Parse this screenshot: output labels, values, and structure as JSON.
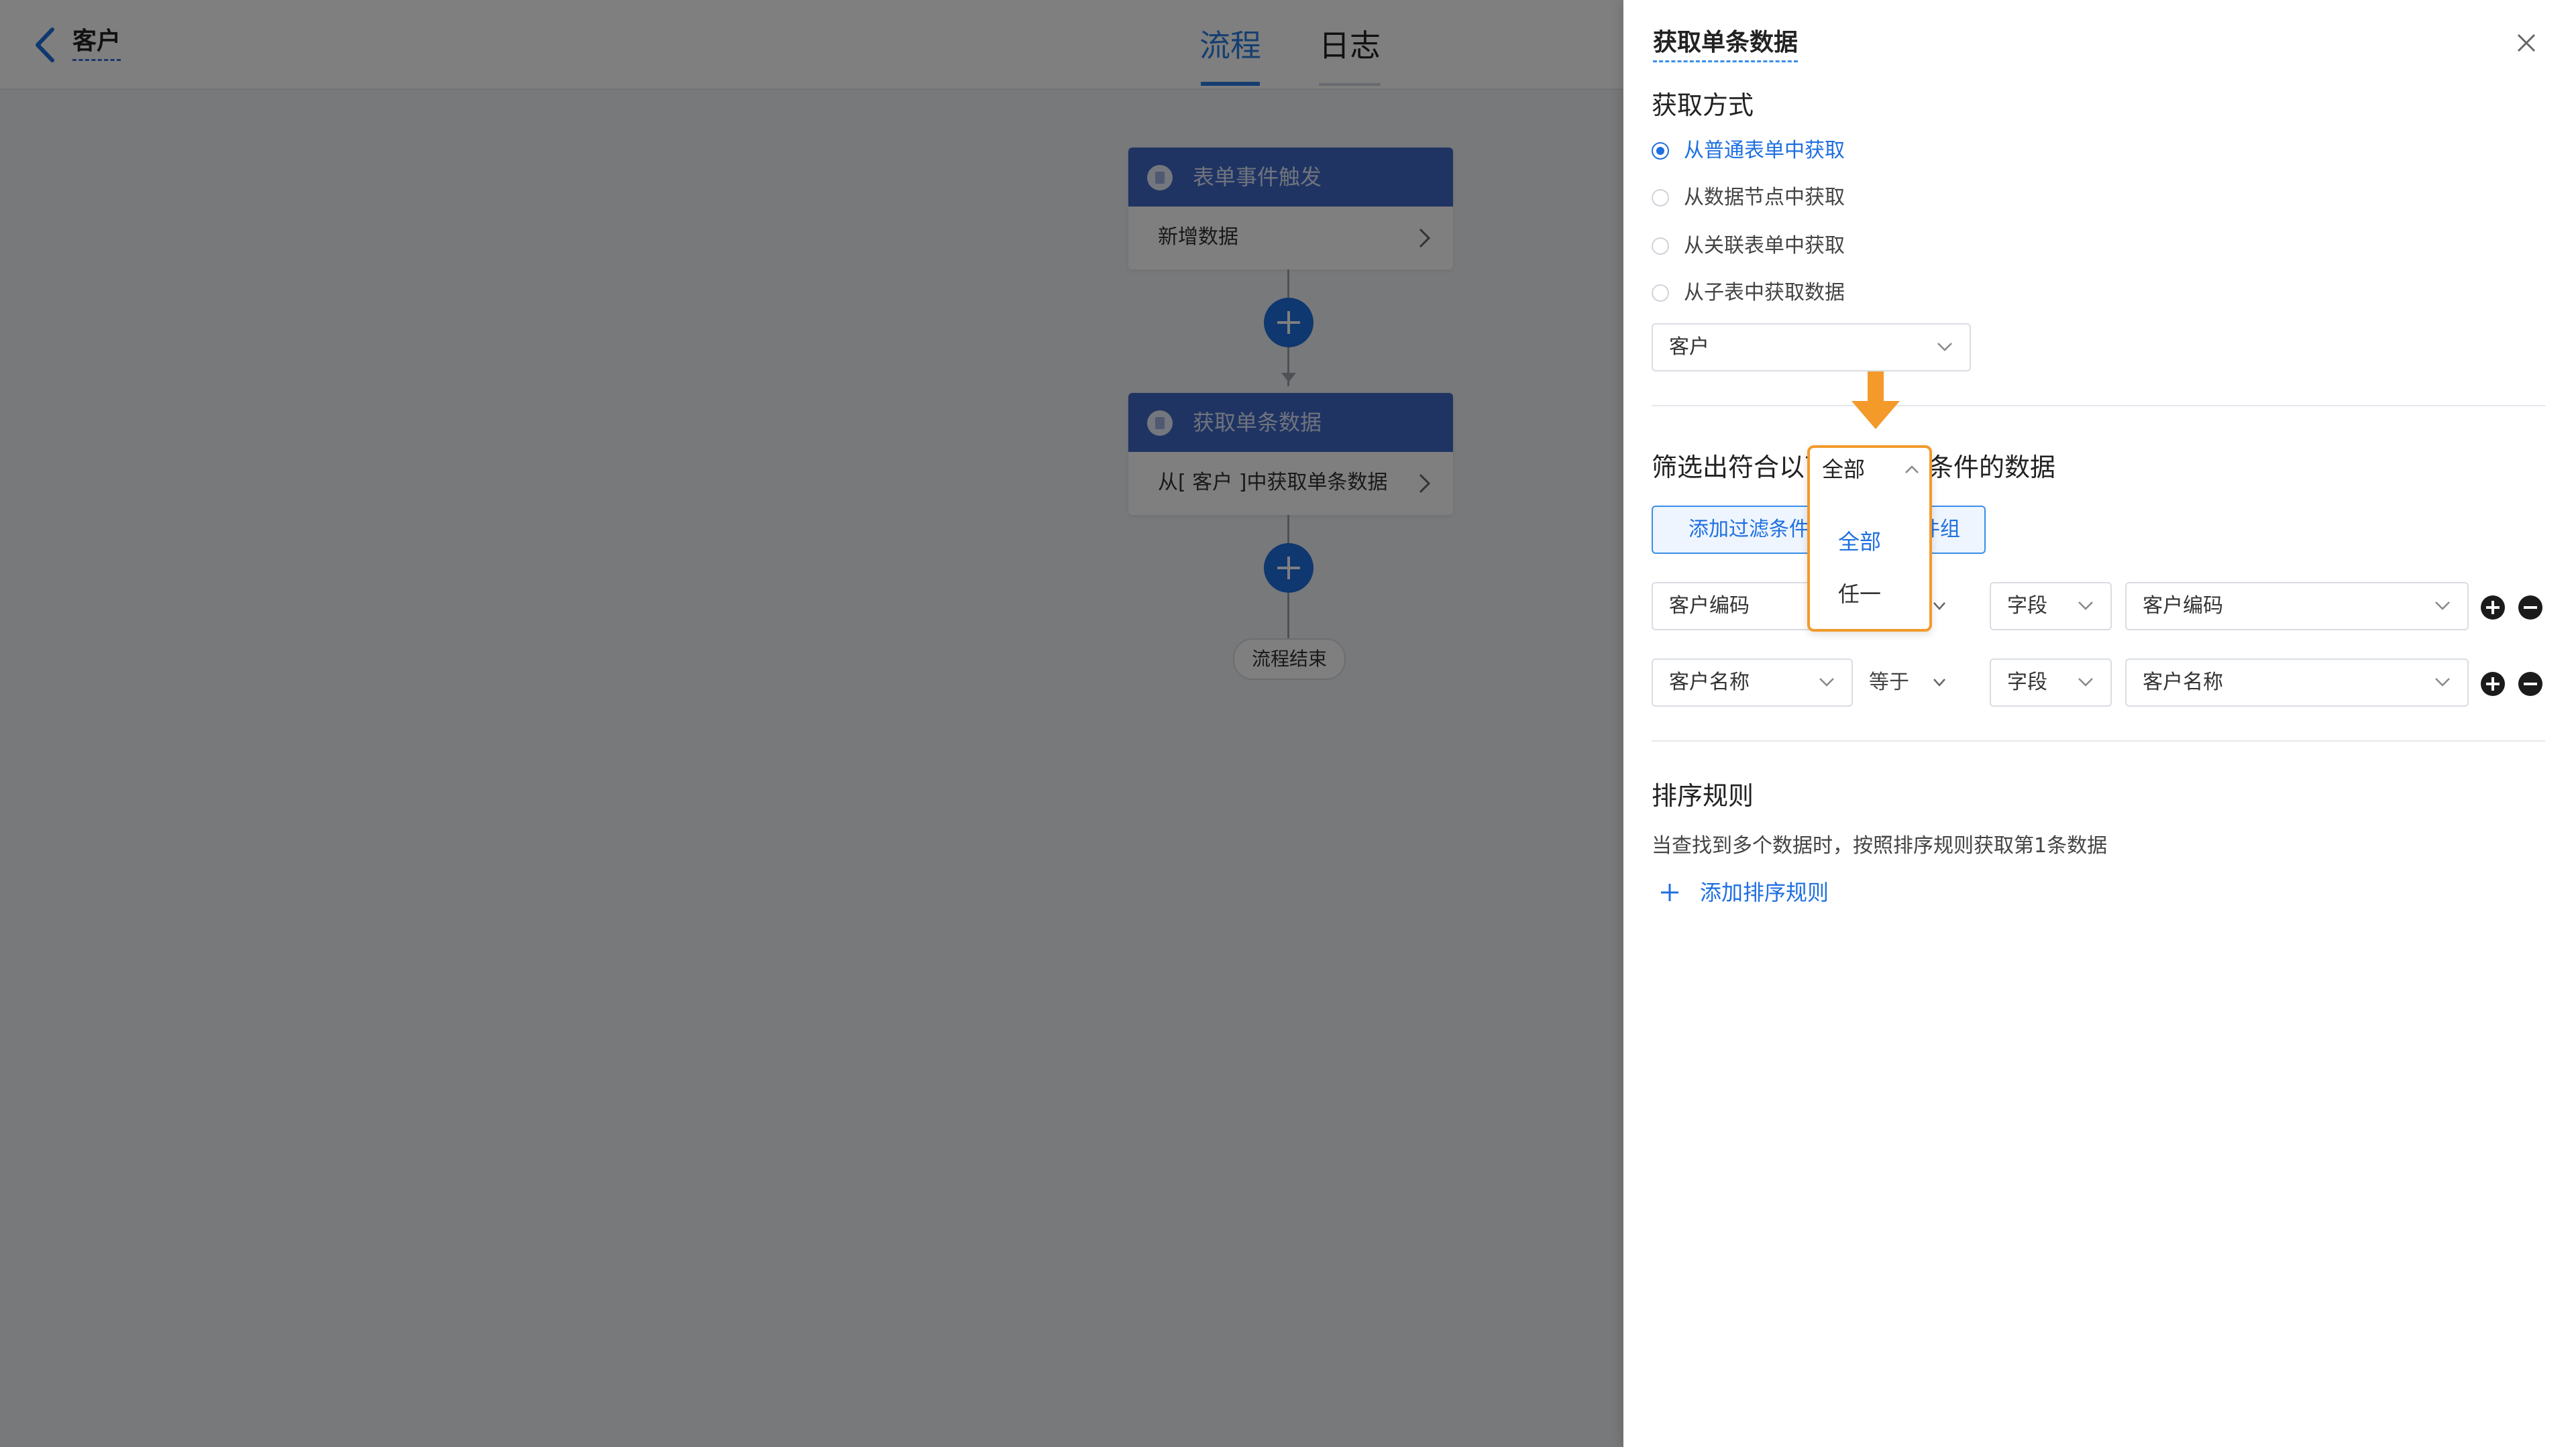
{
  "header": {
    "title": "客户",
    "tabs": [
      {
        "label": "流程",
        "active": true
      },
      {
        "label": "日志",
        "active": false
      }
    ]
  },
  "flow": {
    "nodes": [
      {
        "title": "表单事件触发",
        "body": "新增数据"
      },
      {
        "title": "获取单条数据",
        "body": "从[ 客户 ]中获取单条数据"
      }
    ],
    "end_label": "流程结束"
  },
  "drawer": {
    "title": "获取单条数据",
    "fetch_method": {
      "label": "获取方式",
      "options": [
        {
          "label": "从普通表单中获取",
          "selected": true
        },
        {
          "label": "从数据节点中获取",
          "selected": false
        },
        {
          "label": "从关联表单中获取",
          "selected": false
        },
        {
          "label": "从子表中获取数据",
          "selected": false
        }
      ]
    },
    "form_select": {
      "value": "客户"
    },
    "filter": {
      "label_pre": "筛选出符合以下",
      "label_post": "条件的数据",
      "match_mode": {
        "current": "全部",
        "options": [
          "全部",
          "任一"
        ],
        "selected": "全部"
      },
      "add_filter_label": "添加过滤条件",
      "add_group_label": "条件组",
      "conditions": [
        {
          "field": "客户编码",
          "operator": "等于",
          "value_type": "字段",
          "value": "客户编码"
        },
        {
          "field": "客户名称",
          "operator": "等于",
          "value_type": "字段",
          "value": "客户名称"
        }
      ]
    },
    "sort": {
      "label": "排序规则",
      "description": "当查找到多个数据时，按照排序规则获取第1条数据",
      "add_label": "添加排序规则"
    }
  },
  "icons": {
    "back": "chevron-left-icon",
    "close": "close-icon",
    "node": "document-icon",
    "node_arrow": "chevron-right-icon",
    "add_node": "plus-circle-icon",
    "select": "chevron-down-icon",
    "highlight": "arrow-down-icon"
  },
  "colors": {
    "accent": "#1e6fe0",
    "node_header": "#3f69c7",
    "highlight": "#f39a2b"
  }
}
